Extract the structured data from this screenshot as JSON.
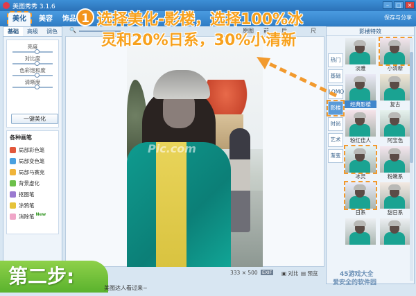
{
  "window": {
    "title": "美图秀秀 3.1.6"
  },
  "main_tabs": [
    "美化",
    "美容",
    "饰品"
  ],
  "share_label": "保存与分享",
  "left_panel": {
    "subtabs": [
      "基础",
      "高级",
      "调色"
    ],
    "adjust_labels": [
      "亮度",
      "对比度",
      "色彩饱和度",
      "清晰度"
    ],
    "adjust_levels": [
      0.5,
      0.5,
      0.5,
      0.5
    ],
    "one_click": "一键美化",
    "brush_title": "各种画笔",
    "brushes": [
      "局部彩色笔",
      "局部变色笔",
      "局部马赛克",
      "背景虚化",
      "抠图笔",
      "涂鸦笔",
      "消除笔"
    ],
    "new_tag": "New"
  },
  "image_toolbar": {
    "items": [
      "原图",
      "前",
      "后",
      "尺"
    ]
  },
  "status": {
    "dimensions": "333 × 500",
    "exif": "EXIF",
    "compare": "对比",
    "preview": "预览"
  },
  "right_panel": {
    "title": "影楼特效",
    "categories": [
      "热门",
      "基础",
      "LOMO",
      "影楼",
      "时尚",
      "艺术",
      "渐变"
    ],
    "active_category": "影楼",
    "thumbs": [
      "淡雅",
      "小清新",
      "经典影楼",
      "复古",
      "粉红佳人",
      "阿宝色",
      "冰灵",
      "粉嫩系",
      "日系",
      "甜日系",
      "",
      ""
    ],
    "highlighted": [
      "小清新",
      "冰灵",
      "日系"
    ],
    "selected": "经典影楼"
  },
  "canvas": {
    "watermark": "Pic.com"
  },
  "tutorial": {
    "step_number": "1",
    "line1": "选择美化-影楼，选择100%冰",
    "line2": "灵和20%日系，30%小清新",
    "banner": "第二步:",
    "bottom_hint": "美图达人看过来~"
  },
  "site": {
    "logo_top": "45游戏大全",
    "logo_bottom": "爱安全的软件园"
  },
  "colors": {
    "accent_orange": "#f29a2e",
    "banner_green": "#5ab22d",
    "title_blue": "#2b72b8"
  }
}
